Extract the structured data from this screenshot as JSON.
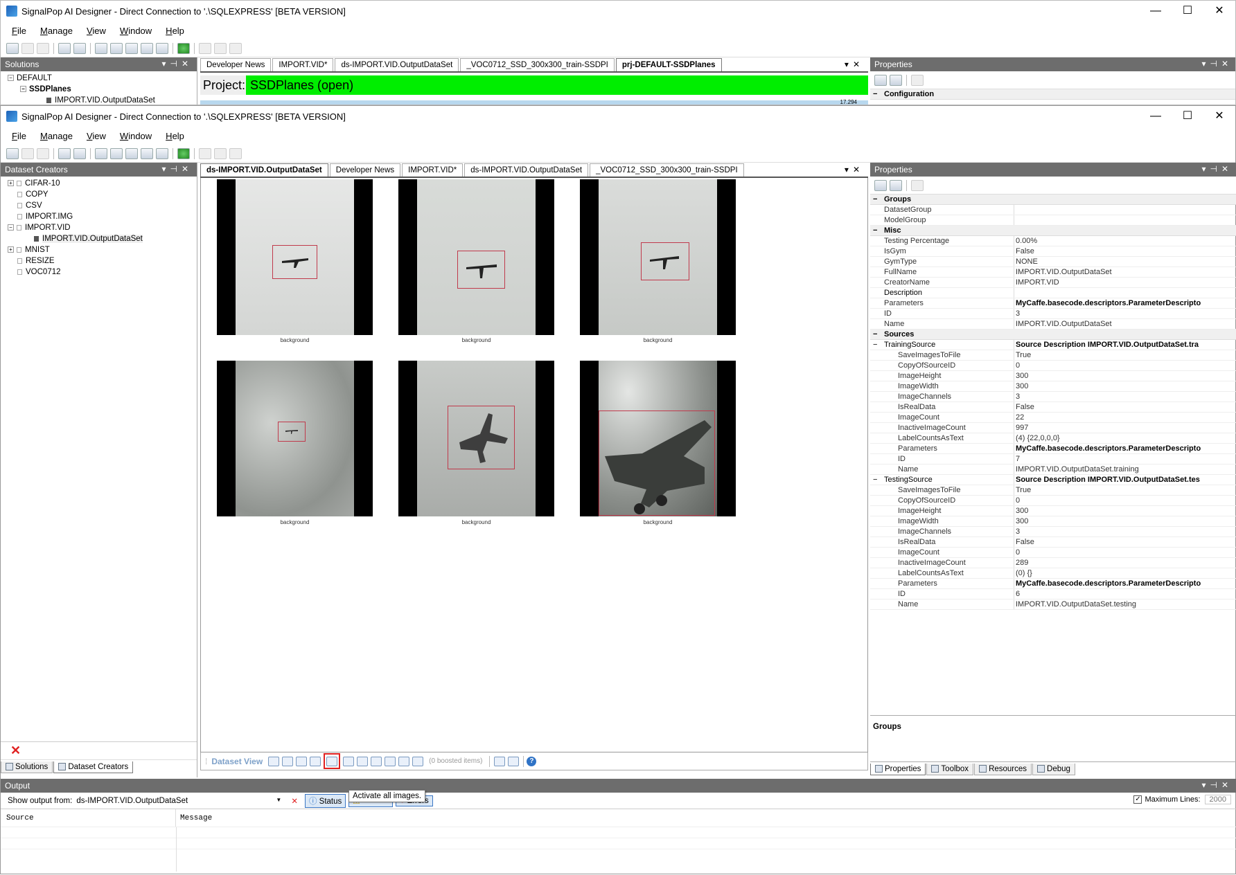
{
  "back_window": {
    "title": "SignalPop AI Designer - Direct Connection to '.\\SQLEXPRESS' [BETA VERSION]",
    "menu": [
      "File",
      "Manage",
      "View",
      "Window",
      "Help"
    ],
    "solutions_header": "Solutions",
    "tree": [
      "DEFAULT",
      "SSDPlanes",
      "IMPORT.VID.OutputDataSet"
    ],
    "tabs": [
      "Developer News",
      "IMPORT.VID*",
      "ds-IMPORT.VID.OutputDataSet",
      "_VOC0712_SSD_300x300_train-SSDPI",
      "prj-DEFAULT-SSDPlanes"
    ],
    "project_label": "Project:",
    "project_name": "SSDPlanes (open)",
    "progress_value": "17.294",
    "props_header": "Properties",
    "props_category": "Configuration"
  },
  "window": {
    "title": "SignalPop AI Designer - Direct Connection to '.\\SQLEXPRESS' [BETA VERSION]",
    "controls": [
      "—",
      "☐",
      "✕"
    ]
  },
  "menu": [
    "File",
    "Manage",
    "View",
    "Window",
    "Help"
  ],
  "left_pane": {
    "header": "Dataset Creators",
    "items": [
      {
        "label": "CIFAR-10",
        "expander": "+"
      },
      {
        "label": "COPY",
        "expander": ""
      },
      {
        "label": "CSV",
        "expander": ""
      },
      {
        "label": "IMPORT.IMG",
        "expander": ""
      },
      {
        "label": "IMPORT.VID",
        "expander": "−"
      },
      {
        "label": "IMPORT.VID.OutputDataSet",
        "expander": ""
      },
      {
        "label": "MNIST",
        "expander": "+"
      },
      {
        "label": "RESIZE",
        "expander": ""
      },
      {
        "label": "VOC0712",
        "expander": ""
      }
    ],
    "bottom_tabs": [
      "Solutions",
      "Dataset Creators"
    ]
  },
  "doc_tabs": [
    "ds-IMPORT.VID.OutputDataSet",
    "Developer News",
    "IMPORT.VID*",
    "ds-IMPORT.VID.OutputDataSet",
    "_VOC0712_SSD_300x300_train-SSDPI"
  ],
  "images": [
    {
      "caption": "background"
    },
    {
      "caption": "background"
    },
    {
      "caption": "background"
    },
    {
      "caption": "background"
    },
    {
      "caption": "background"
    },
    {
      "caption": "background"
    }
  ],
  "dataset_toolbar": {
    "label": "Dataset View",
    "boosted": "(0 boosted items)",
    "tooltip": "Activate all images."
  },
  "properties": {
    "header": "Properties",
    "groups": {
      "title": "Groups",
      "rows": [
        [
          "DatasetGroup",
          ""
        ],
        [
          "ModelGroup",
          ""
        ]
      ]
    },
    "misc": {
      "title": "Misc",
      "rows": [
        [
          "Testing Percentage",
          "0.00%"
        ],
        [
          "IsGym",
          "False"
        ],
        [
          "GymType",
          "NONE"
        ],
        [
          "FullName",
          "IMPORT.VID.OutputDataSet"
        ],
        [
          "CreatorName",
          "IMPORT.VID"
        ],
        [
          "Description",
          ""
        ],
        [
          "Parameters",
          "MyCaffe.basecode.descriptors.ParameterDescripto"
        ],
        [
          "ID",
          "3"
        ],
        [
          "Name",
          "IMPORT.VID.OutputDataSet"
        ]
      ]
    },
    "sources": {
      "title": "Sources",
      "training": {
        "label": "TrainingSource",
        "value": "Source Description IMPORT.VID.OutputDataSet.tra",
        "rows": [
          [
            "SaveImagesToFile",
            "True"
          ],
          [
            "CopyOfSourceID",
            "0"
          ],
          [
            "ImageHeight",
            "300"
          ],
          [
            "ImageWidth",
            "300"
          ],
          [
            "ImageChannels",
            "3"
          ],
          [
            "IsRealData",
            "False"
          ],
          [
            "ImageCount",
            "22"
          ],
          [
            "InactiveImageCount",
            "997"
          ],
          [
            "LabelCountsAsText",
            "(4) {22,0,0,0}"
          ],
          [
            "Parameters",
            "MyCaffe.basecode.descriptors.ParameterDescripto"
          ],
          [
            "ID",
            "7"
          ],
          [
            "Name",
            "IMPORT.VID.OutputDataSet.training"
          ]
        ]
      },
      "testing": {
        "label": "TestingSource",
        "value": "Source Description IMPORT.VID.OutputDataSet.tes",
        "rows": [
          [
            "SaveImagesToFile",
            "True"
          ],
          [
            "CopyOfSourceID",
            "0"
          ],
          [
            "ImageHeight",
            "300"
          ],
          [
            "ImageWidth",
            "300"
          ],
          [
            "ImageChannels",
            "3"
          ],
          [
            "IsRealData",
            "False"
          ],
          [
            "ImageCount",
            "0"
          ],
          [
            "InactiveImageCount",
            "289"
          ],
          [
            "LabelCountsAsText",
            "(0) {}"
          ],
          [
            "Parameters",
            "MyCaffe.basecode.descriptors.ParameterDescripto"
          ],
          [
            "ID",
            "6"
          ],
          [
            "Name",
            "IMPORT.VID.OutputDataSet.testing"
          ]
        ]
      }
    },
    "description_title": "Groups",
    "bottom_tabs": [
      "Properties",
      "Toolbox",
      "Resources",
      "Debug"
    ]
  },
  "output": {
    "header": "Output",
    "show_label": "Show output from:",
    "source_value": "ds-IMPORT.VID.OutputDataSet",
    "status_btn": "Status",
    "errors_btn": "Errors",
    "max_lines_label": "Maximum Lines:",
    "max_lines_value": "2000",
    "col_source": "Source",
    "col_message": "Message"
  }
}
